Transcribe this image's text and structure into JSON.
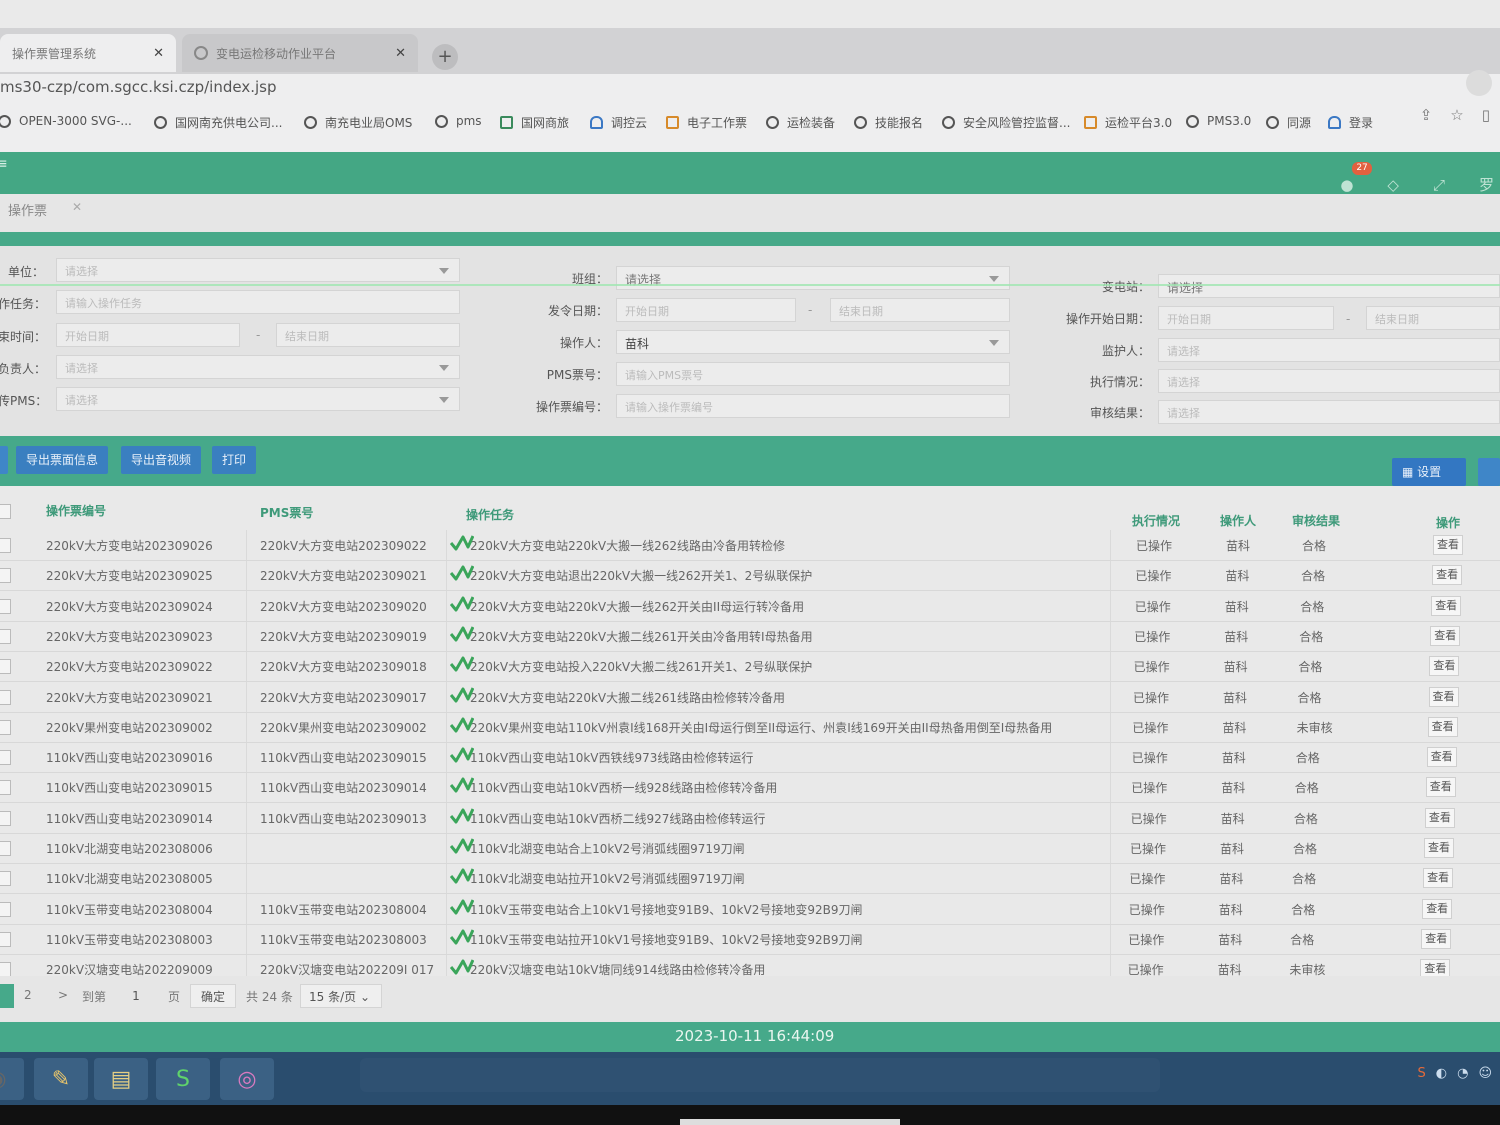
{
  "browser": {
    "tabs": [
      {
        "label": "操作票管理系统"
      },
      {
        "label": "变电运检移动作业平台"
      }
    ],
    "url": "ms30-czp/com.sgcc.ksi.czp/index.jsp",
    "bookmarks": [
      "OPEN-3000 SVG-...",
      "国网南充供电公司...",
      "南充电业局OMS",
      "pms",
      "国网商旅",
      "调控云",
      "电子工作票",
      "运检装备",
      "技能报名",
      "安全风险管控监督...",
      "运检平台3.0",
      "PMS3.0",
      "同源",
      "登录"
    ]
  },
  "header": {
    "notification_count": "27"
  },
  "tags": {
    "active": "操作票"
  },
  "filters": {
    "unit": {
      "label": "单位：",
      "placeholder": "请选择"
    },
    "task": {
      "label": "作任务：",
      "placeholder": "请输入操作任务"
    },
    "end_time": {
      "label": "束时间：",
      "start": "开始日期",
      "end": "结束日期"
    },
    "owner": {
      "label": "负责人：",
      "placeholder": "请选择"
    },
    "pms_transfer": {
      "label": "传PMS：",
      "placeholder": "请选择"
    },
    "team": {
      "label": "班组：",
      "placeholder": "请选择"
    },
    "issue_date": {
      "label": "发令日期：",
      "start": "开始日期",
      "end": "结束日期"
    },
    "operator": {
      "label": "操作人：",
      "value": "苗科"
    },
    "pms_no": {
      "label": "PMS票号：",
      "placeholder": "请输入PMS票号"
    },
    "ticket_no": {
      "label": "操作票编号：",
      "placeholder": "请输入操作票编号"
    },
    "substation": {
      "label": "变电站：",
      "placeholder": "请选择"
    },
    "op_start_date": {
      "label": "操作开始日期：",
      "start": "开始日期",
      "end": "结束日期"
    },
    "guardian": {
      "label": "监护人：",
      "placeholder": "请选择"
    },
    "exec_status": {
      "label": "执行情况：",
      "placeholder": "请选择"
    },
    "audit_result": {
      "label": "审核结果：",
      "placeholder": "请选择"
    }
  },
  "toolbar": {
    "export_info": "导出票面信息",
    "export_video": "导出音视频",
    "print": "打印",
    "settings": "设置"
  },
  "table": {
    "headers": {
      "ticket_no": "操作票编号",
      "pms_no": "PMS票号",
      "task": "操作任务",
      "exec": "执行情况",
      "operator": "操作人",
      "audit": "审核结果",
      "action": "操作"
    },
    "rows": [
      {
        "ticket_no": "220kV大方变电站202309026",
        "pms_no": "220kV大方变电站202309022",
        "task": "220kV大方变电站220kV大搬一线262线路由冷备用转检修",
        "exec": "已操作",
        "operator": "苗科",
        "audit": "合格",
        "action": "查看"
      },
      {
        "ticket_no": "220kV大方变电站202309025",
        "pms_no": "220kV大方变电站202309021",
        "task": "220kV大方变电站退出220kV大搬一线262开关1、2号纵联保护",
        "exec": "已操作",
        "operator": "苗科",
        "audit": "合格",
        "action": "查看"
      },
      {
        "ticket_no": "220kV大方变电站202309024",
        "pms_no": "220kV大方变电站202309020",
        "task": "220kV大方变电站220kV大搬一线262开关由II母运行转冷备用",
        "exec": "已操作",
        "operator": "苗科",
        "audit": "合格",
        "action": "查看"
      },
      {
        "ticket_no": "220kV大方变电站202309023",
        "pms_no": "220kV大方变电站202309019",
        "task": "220kV大方变电站220kV大搬二线261开关由冷备用转I母热备用",
        "exec": "已操作",
        "operator": "苗科",
        "audit": "合格",
        "action": "查看"
      },
      {
        "ticket_no": "220kV大方变电站202309022",
        "pms_no": "220kV大方变电站202309018",
        "task": "220kV大方变电站投入220kV大搬二线261开关1、2号纵联保护",
        "exec": "已操作",
        "operator": "苗科",
        "audit": "合格",
        "action": "查看"
      },
      {
        "ticket_no": "220kV大方变电站202309021",
        "pms_no": "220kV大方变电站202309017",
        "task": "220kV大方变电站220kV大搬二线261线路由检修转冷备用",
        "exec": "已操作",
        "operator": "苗科",
        "audit": "合格",
        "action": "查看"
      },
      {
        "ticket_no": "220kV果州变电站202309002",
        "pms_no": "220kV果州变电站202309002",
        "task": "220kV果州变电站110kV州袁I线168开关由I母运行倒至II母运行、州袁I线169开关由II母热备用倒至I母热备用",
        "exec": "已操作",
        "operator": "苗科",
        "audit": "未审核",
        "action": "查看"
      },
      {
        "ticket_no": "110kV西山变电站202309016",
        "pms_no": "110kV西山变电站202309015",
        "task": "110kV西山变电站10kV西铁线973线路由检修转运行",
        "exec": "已操作",
        "operator": "苗科",
        "audit": "合格",
        "action": "查看"
      },
      {
        "ticket_no": "110kV西山变电站202309015",
        "pms_no": "110kV西山变电站202309014",
        "task": "110kV西山变电站10kV西桥一线928线路由检修转冷备用",
        "exec": "已操作",
        "operator": "苗科",
        "audit": "合格",
        "action": "查看"
      },
      {
        "ticket_no": "110kV西山变电站202309014",
        "pms_no": "110kV西山变电站202309013",
        "task": "110kV西山变电站10kV西桥二线927线路由检修转运行",
        "exec": "已操作",
        "operator": "苗科",
        "audit": "合格",
        "action": "查看"
      },
      {
        "ticket_no": "110kV北湖变电站202308006",
        "pms_no": "",
        "task": "110kV北湖变电站合上10kV2号消弧线圈9719刀闸",
        "exec": "已操作",
        "operator": "苗科",
        "audit": "合格",
        "action": "查看"
      },
      {
        "ticket_no": "110kV北湖变电站202308005",
        "pms_no": "",
        "task": "110kV北湖变电站拉开10kV2号消弧线圈9719刀闸",
        "exec": "已操作",
        "operator": "苗科",
        "audit": "合格",
        "action": "查看"
      },
      {
        "ticket_no": "110kV玉带变电站202308004",
        "pms_no": "110kV玉带变电站202308004",
        "task": "110kV玉带变电站合上10kV1号接地变91B9、10kV2号接地变92B9刀闸",
        "exec": "已操作",
        "operator": "苗科",
        "audit": "合格",
        "action": "查看"
      },
      {
        "ticket_no": "110kV玉带变电站202308003",
        "pms_no": "110kV玉带变电站202308003",
        "task": "110kV玉带变电站拉开10kV1号接地变91B9、10kV2号接地变92B9刀闸",
        "exec": "已操作",
        "operator": "苗科",
        "audit": "合格",
        "action": "查看"
      },
      {
        "ticket_no": "220kV汉塘变电站202209009",
        "pms_no": "220kV汉塘变电站202209I 017",
        "task": "220kV汉塘变电站10kV塘同线914线路由检修转冷备用",
        "exec": "已操作",
        "operator": "苗科",
        "audit": "未审核",
        "action": "查看"
      }
    ]
  },
  "pager": {
    "page2": "2",
    "next": ">",
    "goto_label": "到第",
    "goto_value": "1",
    "page_unit": "页",
    "confirm": "确定",
    "total": "共 24 条",
    "page_size": "15 条/页"
  },
  "footer": {
    "datetime": "2023-10-11 16:44:09"
  }
}
